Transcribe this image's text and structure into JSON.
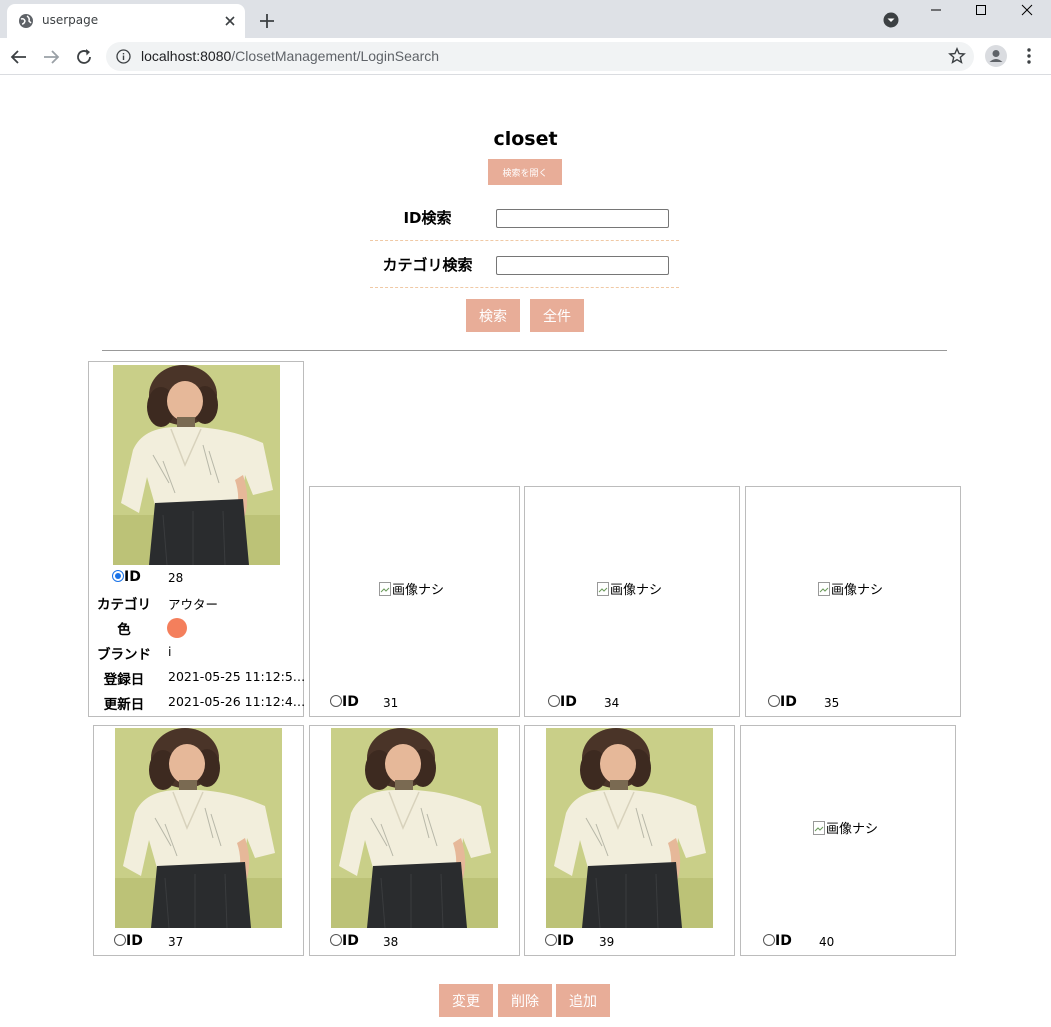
{
  "browser": {
    "tab_title": "userpage",
    "url_host": "localhost:8080",
    "url_path": "/ClosetManagement/LoginSearch"
  },
  "page": {
    "title": "closet",
    "open_search_label": "検索を開く"
  },
  "search": {
    "id_label": "ID検索",
    "id_value": "",
    "category_label": "カテゴリ検索",
    "category_value": "",
    "search_button": "検索",
    "all_button": "全件"
  },
  "selected_item": {
    "id_label": "ID",
    "id": "28",
    "category_label": "カテゴリ",
    "category": "アウター",
    "color_label": "色",
    "color": "#f47f5c",
    "brand_label": "ブランド",
    "brand": "i",
    "created_label": "登録日",
    "created": "2021-05-25 11:12:5…",
    "updated_label": "更新日",
    "updated": "2021-05-26 11:12:4…"
  },
  "no_image_text": "画像ナシ",
  "items": [
    {
      "id_label": "ID",
      "id": "31",
      "has_image": false
    },
    {
      "id_label": "ID",
      "id": "34",
      "has_image": false
    },
    {
      "id_label": "ID",
      "id": "35",
      "has_image": false
    },
    {
      "id_label": "ID",
      "id": "37",
      "has_image": true
    },
    {
      "id_label": "ID",
      "id": "38",
      "has_image": true
    },
    {
      "id_label": "ID",
      "id": "39",
      "has_image": true
    },
    {
      "id_label": "ID",
      "id": "40",
      "has_image": false
    }
  ],
  "footer_buttons": {
    "change": "変更",
    "delete": "削除",
    "add": "追加"
  },
  "colors": {
    "button_bg": "#e8ad98",
    "photo_bg": "#c9d087"
  }
}
